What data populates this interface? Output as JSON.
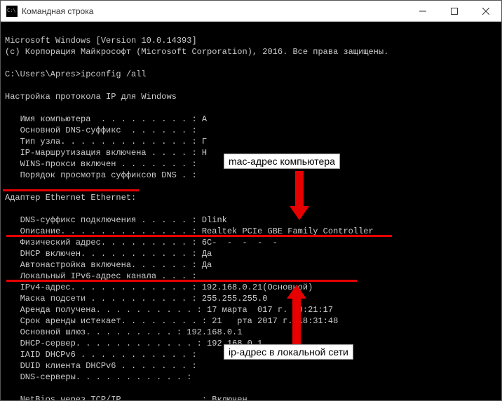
{
  "window": {
    "title": "Командная строка"
  },
  "lines": {
    "l1": "Microsoft Windows [Version 10.0.14393]",
    "l2": "(с) Корпорация Майкрософт (Microsoft Corporation), 2016. Все права защищены.",
    "l3": "",
    "l4": "C:\\Users\\Apres>ipconfig /all",
    "l5": "",
    "l6": "Настройка протокола IP для Windows",
    "l7": "",
    "l8": "   Имя компьютера  . . . . . . . . . : A",
    "l9": "   Основной DNS-суффикс  . . . . . . :",
    "l10": "   Тип узла. . . . . . . . . . . . . : Г",
    "l11": "   IP-маршрутизация включена . . . . : Н",
    "l12": "   WINS-прокси включен . . . . . . . :",
    "l13": "   Порядок просмотра суффиксов DNS . :",
    "l14": "",
    "l15": "Адаптер Ethernet Ethernet:",
    "l16": "",
    "l17": "   DNS-суффикс подключения . . . . . : Dlink",
    "l18": "   Описание. . . . . . . . . . . . . : Realtek PCIe GBE Family Controller",
    "l19": "   Физический адрес. . . . . . . . . : 6C-  -  -  -  -  ",
    "l20": "   DHCP включен. . . . . . . . . . . : Да",
    "l21": "   Автонастройка включена. . . . . . : Да",
    "l22": "   Локальный IPv6-адрес канала . . . :",
    "l23": "   IPv4-адрес. . . . . . . . . . . . : 192.168.0.21(Основной)",
    "l24": "   Маска подсети . . . . . . . . . . : 255.255.255.0",
    "l25": "   Аренда получена. . . . . . . . . . : 17 марта  017 г. 10:21:17",
    "l26": "   Срок аренды истекает. . . . . . . . : 21   рта 2017 г. 18:31:48",
    "l27": "   Основной шлюз. . . . . . . . . : 192.168.0.1",
    "l28": "   DHCP-сервер. . . . . . . . . . . . : 192.168.0.1",
    "l29": "   IAID DHCPv6 . . . . . . . . . . . :",
    "l30": "   DUID клиента DHCPv6 . . . . . . . :",
    "l31": "   DNS-серверы. . . . . . . . . . . :",
    "l32": "",
    "l33": "   NetBios через TCP/IP. . . . . . . . : Включен"
  },
  "annotations": {
    "mac_label": "mac-адрес компьютера",
    "ip_label": "ip-адрес в локальной сети"
  }
}
